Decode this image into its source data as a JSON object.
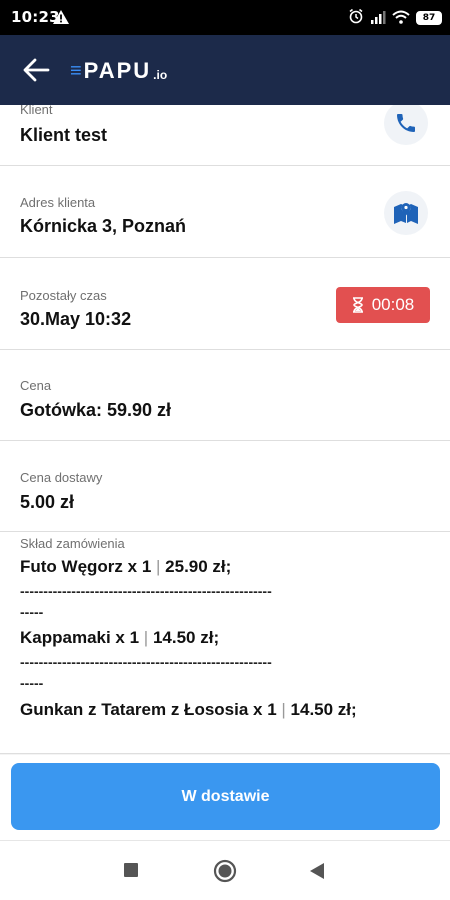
{
  "status_bar": {
    "time": "10:23",
    "battery": "87"
  },
  "app_bar": {
    "logo_mark": "≡",
    "logo_word": "PAPU",
    "logo_tld": ".io"
  },
  "details": {
    "client": {
      "label": "Klient",
      "value": "Klient test"
    },
    "address": {
      "label": "Adres klienta",
      "value": "Kórnicka 3, Poznań"
    },
    "remaining_time": {
      "label": "Pozostały czas",
      "value": "30.May 10:32",
      "timer": "00:08"
    },
    "price": {
      "label": "Cena",
      "value": "Gotówka: 59.90 zł"
    },
    "delivery_price": {
      "label": "Cena dostawy",
      "value": "5.00 zł"
    }
  },
  "order": {
    "label": "Skład zamówienia",
    "separator_line1": "------------------------------------------------------",
    "separator_line2": "-----",
    "items": [
      {
        "name": "Futo Węgorz x 1",
        "pipe": "|",
        "price": "25.90 zł;"
      },
      {
        "name": "Kappamaki x 1",
        "pipe": "|",
        "price": "14.50 zł;"
      },
      {
        "name": "Gunkan z Tatarem z Łososia x 1",
        "pipe": "|",
        "price": "14.50 zł;"
      }
    ]
  },
  "action": {
    "label": "W dostawie"
  },
  "colors": {
    "app_bar": "#1c2a4a",
    "primary": "#3a97f0",
    "timer": "#e25050",
    "icon_accent": "#1f63b8"
  }
}
